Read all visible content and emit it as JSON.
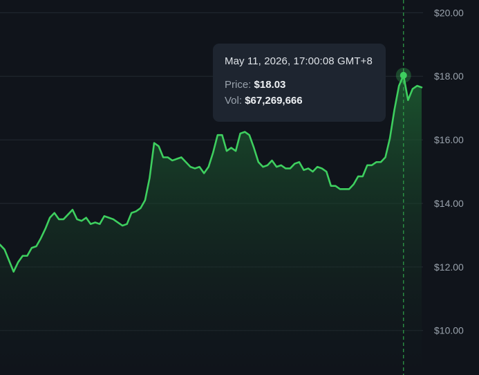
{
  "chart_data": {
    "type": "area",
    "x_axis_visible": false,
    "y_axis_position": "right",
    "ylim": [
      8.6,
      20.4
    ],
    "y_ticks": [
      10,
      12,
      14,
      16,
      18,
      20
    ],
    "y_tick_labels": [
      "$10.00",
      "$12.00",
      "$14.00",
      "$16.00",
      "$18.00",
      "$20.00"
    ],
    "grid": true,
    "colors": {
      "background": "#10141b",
      "line": "#3ecf5f",
      "grid": "#232a33",
      "crosshair": "#2fa44a",
      "fill_top": "#1f6a35",
      "fill_bottom": "#10141b"
    },
    "series": [
      {
        "values": [
          12.7,
          12.55,
          12.2,
          11.85,
          12.15,
          12.35,
          12.35,
          12.6,
          12.65,
          12.9,
          13.2,
          13.55,
          13.7,
          13.5,
          13.5,
          13.65,
          13.8,
          13.5,
          13.45,
          13.55,
          13.35,
          13.4,
          13.35,
          13.6,
          13.55,
          13.5,
          13.4,
          13.3,
          13.35,
          13.7,
          13.75,
          13.85,
          14.1,
          14.8,
          15.9,
          15.8,
          15.45,
          15.45,
          15.35,
          15.4,
          15.45,
          15.3,
          15.15,
          15.1,
          15.15,
          14.95,
          15.15,
          15.6,
          16.15,
          16.15,
          15.65,
          15.75,
          15.65,
          16.2,
          16.25,
          16.15,
          15.75,
          15.3,
          15.15,
          15.2,
          15.35,
          15.15,
          15.2,
          15.1,
          15.1,
          15.25,
          15.3,
          15.05,
          15.1,
          15.0,
          15.15,
          15.1,
          15.0,
          14.55,
          14.55,
          14.45,
          14.45,
          14.45,
          14.6,
          14.85,
          14.85,
          15.2,
          15.2,
          15.3,
          15.3,
          15.45,
          16.05,
          16.95,
          17.7,
          18.03,
          17.25,
          17.6,
          17.7,
          17.65
        ]
      }
    ],
    "hover_index": 89,
    "tooltip": {
      "date": "May 11, 2026, 17:00:08 GMT+8",
      "price_key": "Price:",
      "price_val": "$18.03",
      "vol_key": "Vol:",
      "vol_val": "$67,269,666"
    }
  }
}
